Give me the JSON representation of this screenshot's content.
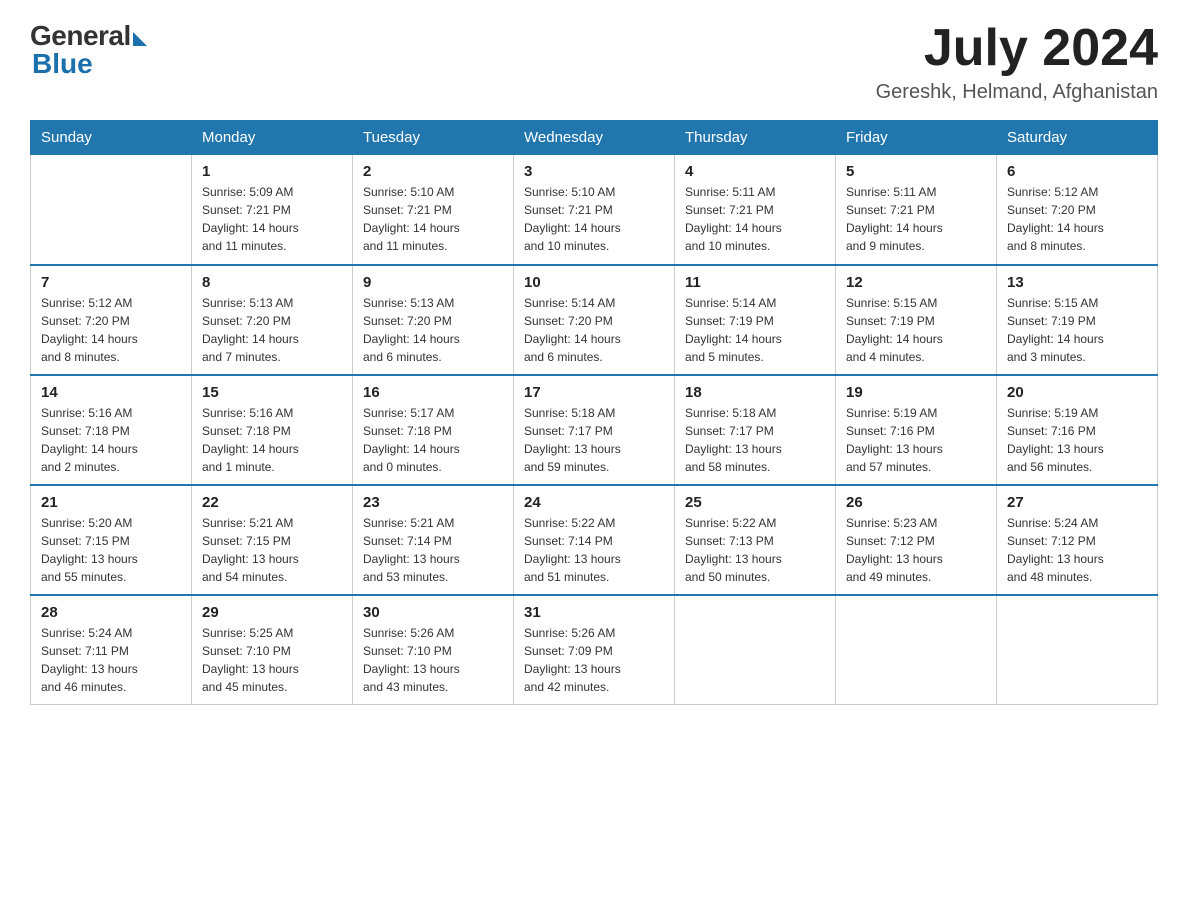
{
  "header": {
    "logo_general": "General",
    "logo_blue": "Blue",
    "month_year": "July 2024",
    "location": "Gereshk, Helmand, Afghanistan"
  },
  "columns": [
    "Sunday",
    "Monday",
    "Tuesday",
    "Wednesday",
    "Thursday",
    "Friday",
    "Saturday"
  ],
  "weeks": [
    [
      {
        "day": "",
        "info": ""
      },
      {
        "day": "1",
        "info": "Sunrise: 5:09 AM\nSunset: 7:21 PM\nDaylight: 14 hours\nand 11 minutes."
      },
      {
        "day": "2",
        "info": "Sunrise: 5:10 AM\nSunset: 7:21 PM\nDaylight: 14 hours\nand 11 minutes."
      },
      {
        "day": "3",
        "info": "Sunrise: 5:10 AM\nSunset: 7:21 PM\nDaylight: 14 hours\nand 10 minutes."
      },
      {
        "day": "4",
        "info": "Sunrise: 5:11 AM\nSunset: 7:21 PM\nDaylight: 14 hours\nand 10 minutes."
      },
      {
        "day": "5",
        "info": "Sunrise: 5:11 AM\nSunset: 7:21 PM\nDaylight: 14 hours\nand 9 minutes."
      },
      {
        "day": "6",
        "info": "Sunrise: 5:12 AM\nSunset: 7:20 PM\nDaylight: 14 hours\nand 8 minutes."
      }
    ],
    [
      {
        "day": "7",
        "info": "Sunrise: 5:12 AM\nSunset: 7:20 PM\nDaylight: 14 hours\nand 8 minutes."
      },
      {
        "day": "8",
        "info": "Sunrise: 5:13 AM\nSunset: 7:20 PM\nDaylight: 14 hours\nand 7 minutes."
      },
      {
        "day": "9",
        "info": "Sunrise: 5:13 AM\nSunset: 7:20 PM\nDaylight: 14 hours\nand 6 minutes."
      },
      {
        "day": "10",
        "info": "Sunrise: 5:14 AM\nSunset: 7:20 PM\nDaylight: 14 hours\nand 6 minutes."
      },
      {
        "day": "11",
        "info": "Sunrise: 5:14 AM\nSunset: 7:19 PM\nDaylight: 14 hours\nand 5 minutes."
      },
      {
        "day": "12",
        "info": "Sunrise: 5:15 AM\nSunset: 7:19 PM\nDaylight: 14 hours\nand 4 minutes."
      },
      {
        "day": "13",
        "info": "Sunrise: 5:15 AM\nSunset: 7:19 PM\nDaylight: 14 hours\nand 3 minutes."
      }
    ],
    [
      {
        "day": "14",
        "info": "Sunrise: 5:16 AM\nSunset: 7:18 PM\nDaylight: 14 hours\nand 2 minutes."
      },
      {
        "day": "15",
        "info": "Sunrise: 5:16 AM\nSunset: 7:18 PM\nDaylight: 14 hours\nand 1 minute."
      },
      {
        "day": "16",
        "info": "Sunrise: 5:17 AM\nSunset: 7:18 PM\nDaylight: 14 hours\nand 0 minutes."
      },
      {
        "day": "17",
        "info": "Sunrise: 5:18 AM\nSunset: 7:17 PM\nDaylight: 13 hours\nand 59 minutes."
      },
      {
        "day": "18",
        "info": "Sunrise: 5:18 AM\nSunset: 7:17 PM\nDaylight: 13 hours\nand 58 minutes."
      },
      {
        "day": "19",
        "info": "Sunrise: 5:19 AM\nSunset: 7:16 PM\nDaylight: 13 hours\nand 57 minutes."
      },
      {
        "day": "20",
        "info": "Sunrise: 5:19 AM\nSunset: 7:16 PM\nDaylight: 13 hours\nand 56 minutes."
      }
    ],
    [
      {
        "day": "21",
        "info": "Sunrise: 5:20 AM\nSunset: 7:15 PM\nDaylight: 13 hours\nand 55 minutes."
      },
      {
        "day": "22",
        "info": "Sunrise: 5:21 AM\nSunset: 7:15 PM\nDaylight: 13 hours\nand 54 minutes."
      },
      {
        "day": "23",
        "info": "Sunrise: 5:21 AM\nSunset: 7:14 PM\nDaylight: 13 hours\nand 53 minutes."
      },
      {
        "day": "24",
        "info": "Sunrise: 5:22 AM\nSunset: 7:14 PM\nDaylight: 13 hours\nand 51 minutes."
      },
      {
        "day": "25",
        "info": "Sunrise: 5:22 AM\nSunset: 7:13 PM\nDaylight: 13 hours\nand 50 minutes."
      },
      {
        "day": "26",
        "info": "Sunrise: 5:23 AM\nSunset: 7:12 PM\nDaylight: 13 hours\nand 49 minutes."
      },
      {
        "day": "27",
        "info": "Sunrise: 5:24 AM\nSunset: 7:12 PM\nDaylight: 13 hours\nand 48 minutes."
      }
    ],
    [
      {
        "day": "28",
        "info": "Sunrise: 5:24 AM\nSunset: 7:11 PM\nDaylight: 13 hours\nand 46 minutes."
      },
      {
        "day": "29",
        "info": "Sunrise: 5:25 AM\nSunset: 7:10 PM\nDaylight: 13 hours\nand 45 minutes."
      },
      {
        "day": "30",
        "info": "Sunrise: 5:26 AM\nSunset: 7:10 PM\nDaylight: 13 hours\nand 43 minutes."
      },
      {
        "day": "31",
        "info": "Sunrise: 5:26 AM\nSunset: 7:09 PM\nDaylight: 13 hours\nand 42 minutes."
      },
      {
        "day": "",
        "info": ""
      },
      {
        "day": "",
        "info": ""
      },
      {
        "day": "",
        "info": ""
      }
    ]
  ]
}
